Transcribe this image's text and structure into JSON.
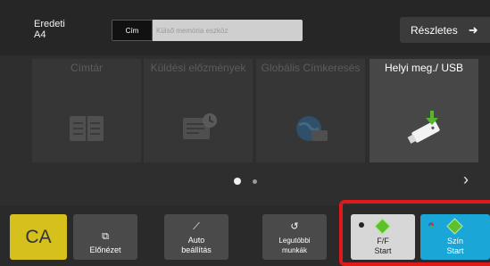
{
  "header": {
    "original_label": "Eredeti",
    "original_size": "A4",
    "address_tag": "Cím",
    "address_placeholder": "Külső memória eszköz",
    "details_label": "Részletes"
  },
  "tiles": [
    {
      "label": "Címtár",
      "icon": "address-book-icon",
      "active": false
    },
    {
      "label": "Küldési előzmények",
      "icon": "send-history-icon",
      "active": false
    },
    {
      "label": "Globális Címkeresés",
      "icon": "global-search-icon",
      "active": false
    },
    {
      "label": "Helyi meg./ USB",
      "icon": "usb-icon",
      "active": true
    }
  ],
  "pagination": {
    "current": 1,
    "total": 2
  },
  "bottom": {
    "ca_label": "CA",
    "preview_label": "Előnézet",
    "auto_label": "Auto beállítás",
    "recent_label": "Legutóbbi munkák",
    "bw_start_label": "F/F Start",
    "color_start_label": "Szín Start"
  },
  "colors": {
    "ca_button": "#d6c01b",
    "color_start": "#1aa6d6",
    "bw_start": "#d7d7d7",
    "highlight_frame": "#e0191b",
    "start_diamond": "#5cc12b"
  }
}
